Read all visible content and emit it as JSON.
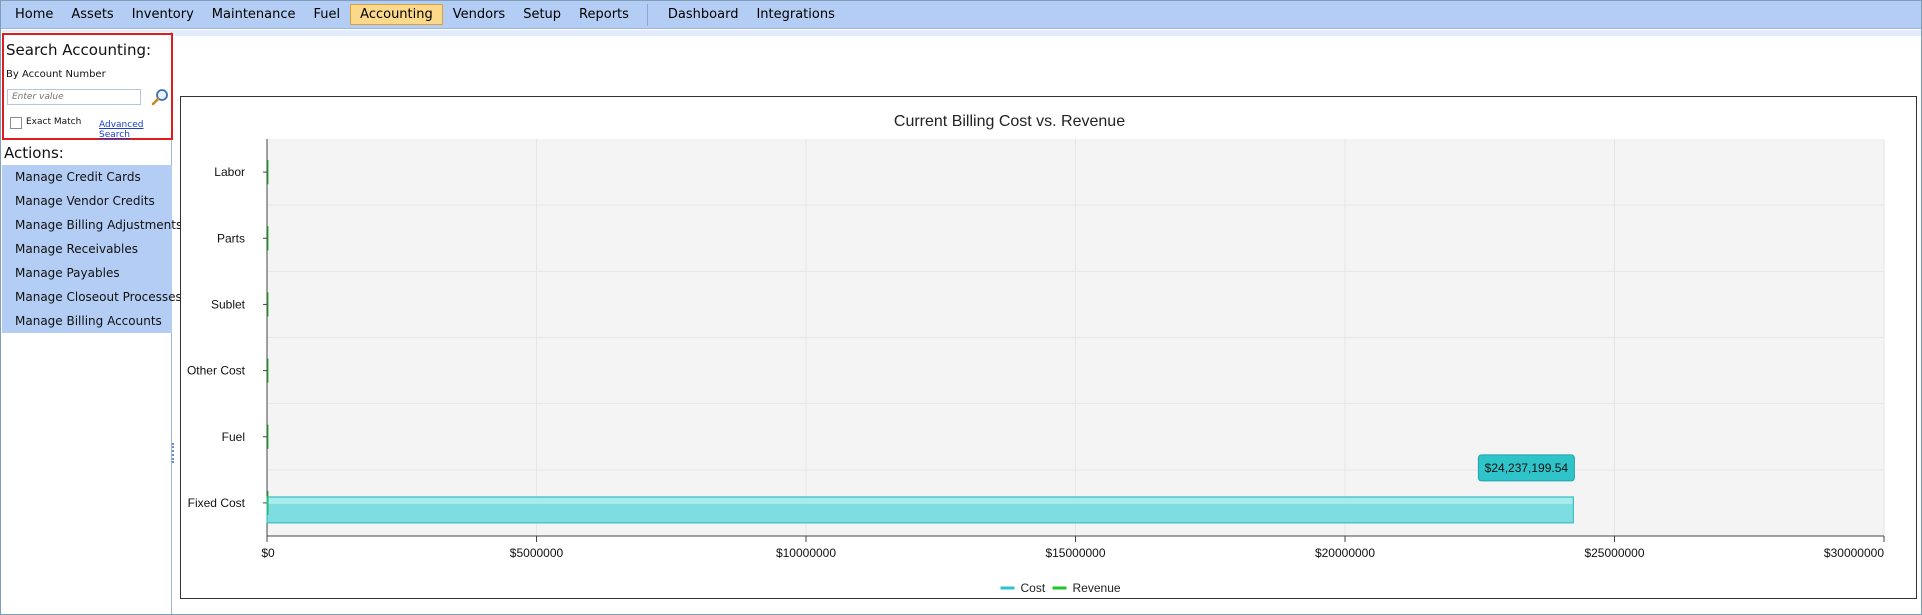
{
  "menu": {
    "items": [
      {
        "label": "Home",
        "active": false
      },
      {
        "label": "Assets",
        "active": false
      },
      {
        "label": "Inventory",
        "active": false
      },
      {
        "label": "Maintenance",
        "active": false
      },
      {
        "label": "Fuel",
        "active": false
      },
      {
        "label": "Accounting",
        "active": true
      },
      {
        "label": "Vendors",
        "active": false
      },
      {
        "label": "Setup",
        "active": false
      },
      {
        "label": "Reports",
        "active": false
      }
    ],
    "secondary": [
      {
        "label": "Dashboard"
      },
      {
        "label": "Integrations"
      }
    ]
  },
  "search": {
    "title": "Search Accounting:",
    "subtitle": "By Account Number",
    "placeholder": "Enter value",
    "value": "",
    "exact_match_label": "Exact Match",
    "exact_match_checked": false,
    "advanced_link": "Advanced Search",
    "search_icon": "magnifier-icon"
  },
  "actions": {
    "title": "Actions:",
    "items": [
      "Manage Credit Cards",
      "Manage Vendor Credits",
      "Manage Billing Adjustments",
      "Manage Receivables",
      "Manage Payables",
      "Manage Closeout Processes",
      "Manage Billing Accounts"
    ]
  },
  "chart_data": {
    "type": "bar",
    "orientation": "horizontal",
    "title": "Current Billing Cost vs. Revenue",
    "categories": [
      "Labor",
      "Parts",
      "Sublet",
      "Other Cost",
      "Fuel",
      "Fixed Cost"
    ],
    "series": [
      {
        "name": "Cost",
        "color": "#2ec4c9",
        "values": [
          0,
          0,
          0,
          0,
          0,
          24237199.54
        ]
      },
      {
        "name": "Revenue",
        "color": "#22c42a",
        "values": [
          0,
          0,
          0,
          0,
          0,
          0
        ]
      }
    ],
    "xlim": [
      0,
      30000000
    ],
    "x_ticks": [
      0,
      5000000,
      10000000,
      15000000,
      20000000,
      25000000,
      30000000
    ],
    "x_tick_labels": [
      "$0",
      "$5000000",
      "$10000000",
      "$15000000",
      "$20000000",
      "$25000000",
      "$30000000"
    ],
    "tooltip": {
      "category": "Fixed Cost",
      "series": "Cost",
      "text": "$24,237,199.54"
    },
    "legend_position": "bottom-center",
    "grid": true
  },
  "colors": {
    "menu_bg": "#b4cdf5",
    "active_menu_bg": "#fbd88a",
    "search_border": "#e01b1b",
    "actions_bg": "#b4cdf5",
    "plot_bg": "#f4f4f4"
  }
}
